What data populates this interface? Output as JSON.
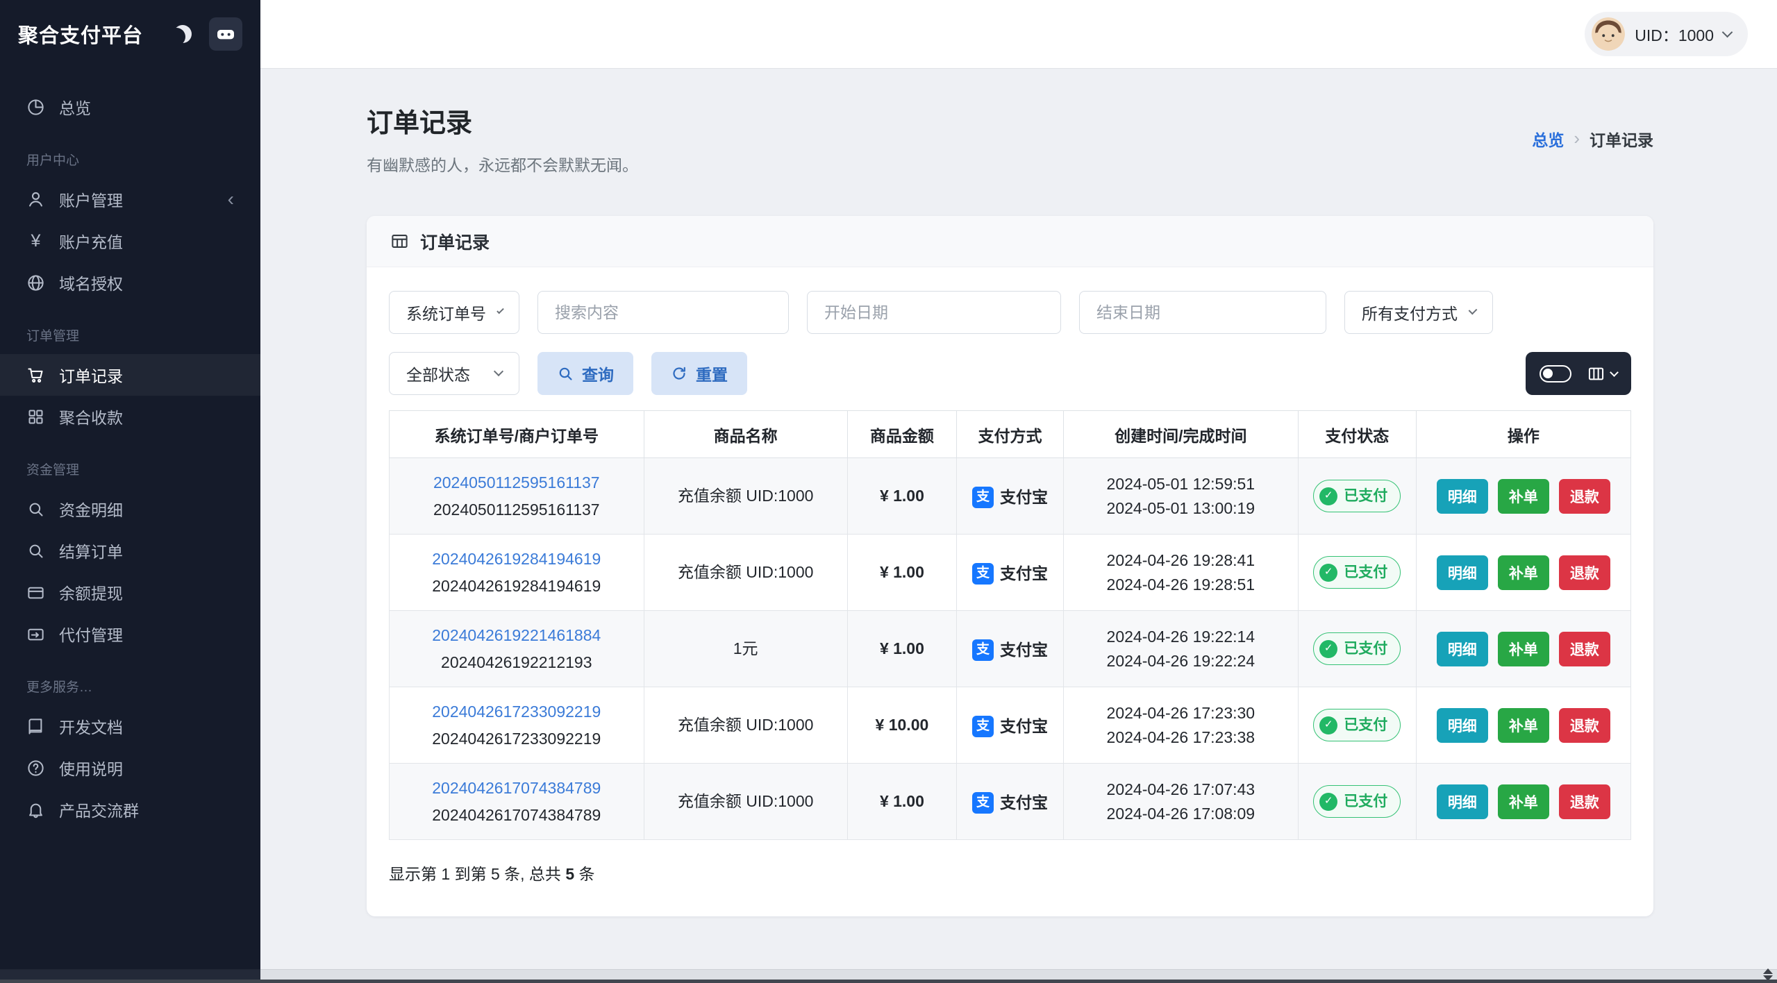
{
  "brand": {
    "title": "聚合支付平台"
  },
  "topbar": {
    "uid_label": "UID：1000"
  },
  "sidebar": {
    "sections": [
      {
        "label": "",
        "items": [
          {
            "id": "overview",
            "label": "总览",
            "icon": "overview"
          }
        ]
      },
      {
        "label": "用户中心",
        "items": [
          {
            "id": "account-management",
            "label": "账户管理",
            "icon": "user",
            "chevron": true
          },
          {
            "id": "account-recharge",
            "label": "账户充值",
            "icon": "yen"
          },
          {
            "id": "domain-auth",
            "label": "域名授权",
            "icon": "globe"
          }
        ]
      },
      {
        "label": "订单管理",
        "items": [
          {
            "id": "order-records",
            "label": "订单记录",
            "icon": "cart",
            "active": true
          },
          {
            "id": "aggregate-collection",
            "label": "聚合收款",
            "icon": "grid"
          }
        ]
      },
      {
        "label": "资金管理",
        "items": [
          {
            "id": "fund-details",
            "label": "资金明细",
            "icon": "search"
          },
          {
            "id": "settlement-orders",
            "label": "结算订单",
            "icon": "search"
          },
          {
            "id": "balance-withdraw",
            "label": "余额提现",
            "icon": "card"
          },
          {
            "id": "payout-management",
            "label": "代付管理",
            "icon": "card-arrow"
          }
        ]
      },
      {
        "label": "更多服务…",
        "items": [
          {
            "id": "dev-docs",
            "label": "开发文档",
            "icon": "book"
          },
          {
            "id": "usage-guide",
            "label": "使用说明",
            "icon": "question"
          },
          {
            "id": "product-group",
            "label": "产品交流群",
            "icon": "bell"
          }
        ]
      }
    ]
  },
  "page": {
    "title": "订单记录",
    "subtitle": "有幽默感的人，永远都不会默默无闻。",
    "breadcrumb": {
      "root": "总览",
      "current": "订单记录"
    }
  },
  "card": {
    "header": "订单记录",
    "filters": {
      "order_field": "系统订单号",
      "search_placeholder": "搜索内容",
      "start_date_placeholder": "开始日期",
      "end_date_placeholder": "结束日期",
      "pay_method": "所有支付方式",
      "status": "全部状态",
      "query": "查询",
      "reset": "重置"
    },
    "table": {
      "columns": [
        "系统订单号/商户订单号",
        "商品名称",
        "商品金额",
        "支付方式",
        "创建时间/完成时间",
        "支付状态",
        "操作"
      ],
      "rows": [
        {
          "order_no": "2024050112595161137",
          "merchant_no": "2024050112595161137",
          "product": "充值余额 UID:1000",
          "amount": "¥ 1.00",
          "pay_method": "支付宝",
          "created": "2024-05-01 12:59:51",
          "completed": "2024-05-01 13:00:19",
          "status": "已支付",
          "actions": [
            "明细",
            "补单",
            "退款"
          ]
        },
        {
          "order_no": "2024042619284194619",
          "merchant_no": "2024042619284194619",
          "product": "充值余额 UID:1000",
          "amount": "¥ 1.00",
          "pay_method": "支付宝",
          "created": "2024-04-26 19:28:41",
          "completed": "2024-04-26 19:28:51",
          "status": "已支付",
          "actions": [
            "明细",
            "补单",
            "退款"
          ]
        },
        {
          "order_no": "2024042619221461884",
          "merchant_no": "20240426192212193",
          "product": "1元",
          "amount": "¥ 1.00",
          "pay_method": "支付宝",
          "created": "2024-04-26 19:22:14",
          "completed": "2024-04-26 19:22:24",
          "status": "已支付",
          "actions": [
            "明细",
            "补单",
            "退款"
          ]
        },
        {
          "order_no": "2024042617233092219",
          "merchant_no": "2024042617233092219",
          "product": "充值余额 UID:1000",
          "amount": "¥ 10.00",
          "pay_method": "支付宝",
          "created": "2024-04-26 17:23:30",
          "completed": "2024-04-26 17:23:38",
          "status": "已支付",
          "actions": [
            "明细",
            "补单",
            "退款"
          ]
        },
        {
          "order_no": "2024042617074384789",
          "merchant_no": "2024042617074384789",
          "product": "充值余额 UID:1000",
          "amount": "¥ 1.00",
          "pay_method": "支付宝",
          "created": "2024-04-26 17:07:43",
          "completed": "2024-04-26 17:08:09",
          "status": "已支付",
          "actions": [
            "明细",
            "补单",
            "退款"
          ]
        }
      ]
    },
    "footer": {
      "prefix": "显示第 1 到第 5 条, 总共",
      "total": "5",
      "suffix": "条"
    }
  },
  "colors": {
    "sidebar_bg": "#151b2a",
    "link": "#3b7bd8",
    "primary_soft_button_bg": "#d7e4f7",
    "primary_soft_button_text": "#2e6bc0",
    "status_paid_green": "#1fab5e",
    "action_detail": "#17a2b8",
    "action_supplement": "#28a745",
    "action_refund": "#dc3545",
    "alipay_blue": "#1677ff"
  }
}
